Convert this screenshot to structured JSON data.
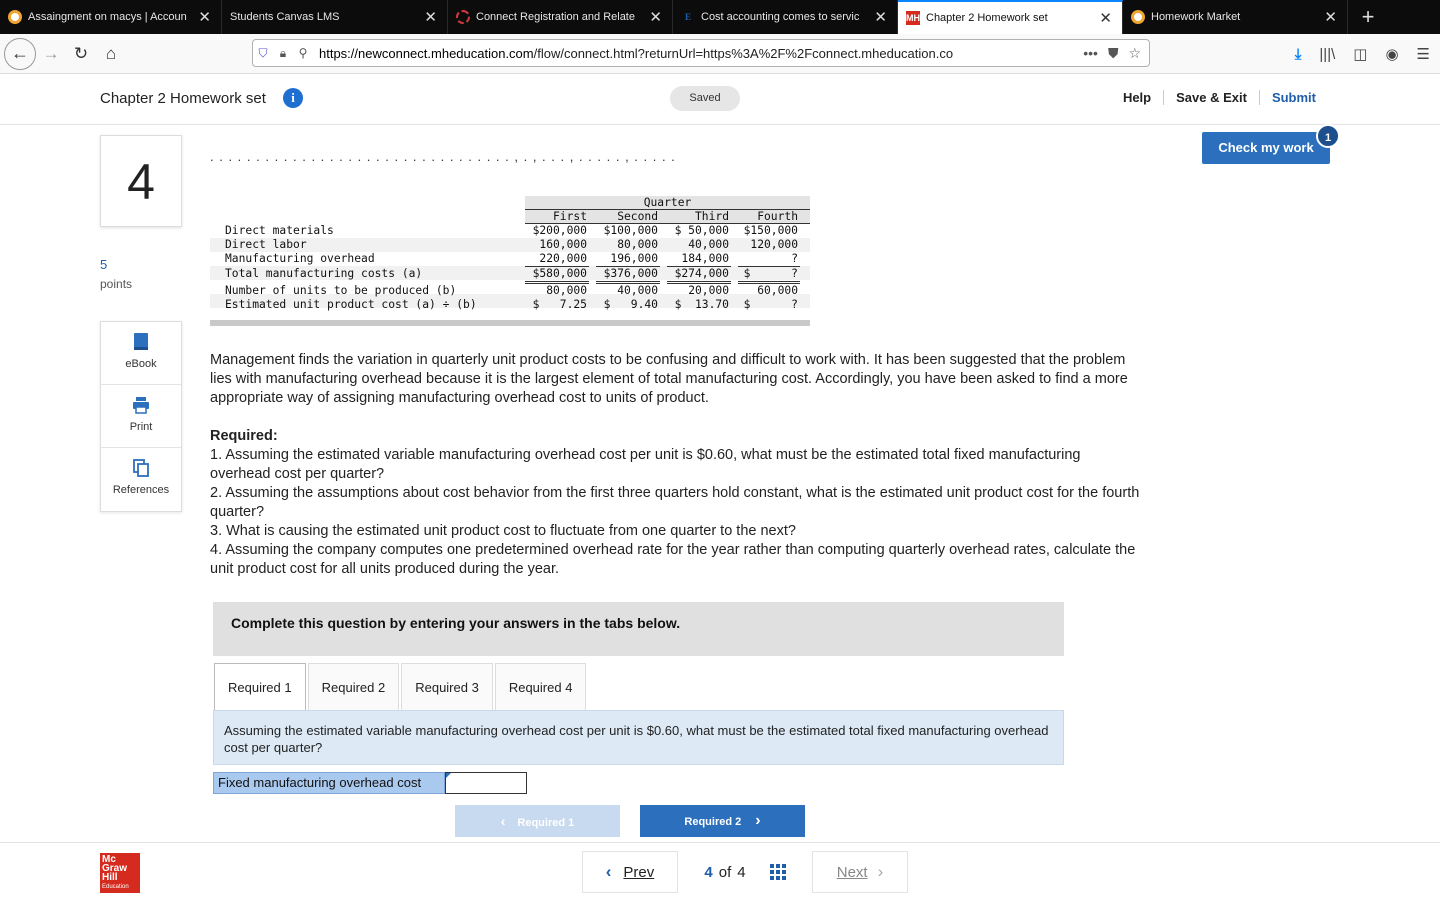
{
  "browser": {
    "tabs": [
      {
        "label": "Assaingment on macys | Accoun",
        "active": false
      },
      {
        "label": "Students Canvas LMS",
        "active": false
      },
      {
        "label": "Connect Registration and Relate",
        "active": false
      },
      {
        "label": "Cost accounting comes to servic",
        "active": false
      },
      {
        "label": "Chapter 2 Homework set",
        "active": true
      },
      {
        "label": "Homework Market",
        "active": false
      }
    ],
    "new_tab": "+",
    "url_host": "https://newconnect.mheducation.com",
    "url_path": "/flow/connect.html?returnUrl=https%3A%2F%2Fconnect.mheducation.co",
    "url_more": "•••"
  },
  "header": {
    "title": "Chapter 2 Homework set",
    "info": "i",
    "saved": "Saved",
    "help": "Help",
    "save_exit": "Save & Exit",
    "submit": "Submit"
  },
  "check_work": {
    "label": "Check my work",
    "badge": "1"
  },
  "question": {
    "number": "4",
    "points_value": "5",
    "points_label": "points",
    "tools": [
      {
        "label": "eBook",
        "icon": "book-icon"
      },
      {
        "label": "Print",
        "icon": "printer-icon"
      },
      {
        "label": "References",
        "icon": "copy-icon"
      }
    ]
  },
  "table": {
    "group_header": "Quarter",
    "columns": [
      "First",
      "Second",
      "Third",
      "Fourth"
    ],
    "rows": [
      {
        "label": "Direct materials",
        "values": [
          "$200,000",
          "$100,000",
          "$ 50,000",
          "$150,000"
        ]
      },
      {
        "label": "Direct labor",
        "values": [
          "160,000",
          "80,000",
          "40,000",
          "120,000"
        ]
      },
      {
        "label": "Manufacturing overhead",
        "values": [
          "220,000",
          "196,000",
          "184,000",
          "?"
        ]
      },
      {
        "label": "Total manufacturing costs (a)",
        "values": [
          "$580,000",
          "$376,000",
          "$274,000",
          "$      ?"
        ]
      },
      {
        "label": "Number of units to be produced (b)",
        "values": [
          "80,000",
          "40,000",
          "20,000",
          "60,000"
        ]
      },
      {
        "label": "Estimated unit product cost (a) ÷ (b)",
        "values": [
          "$   7.25",
          "$   9.40",
          "$  13.70",
          "$      ?"
        ]
      }
    ]
  },
  "body": {
    "intro": "Management finds the variation in quarterly unit product costs to be confusing and difficult to work with. It has been suggested that the problem lies with manufacturing overhead because it is the largest element of total manufacturing cost. Accordingly, you have been asked to find a more appropriate way of assigning manufacturing overhead cost to units of product.",
    "required_title": "Required:",
    "required_items": [
      "1. Assuming the estimated variable manufacturing overhead cost per unit is $0.60, what must be the estimated total fixed manufacturing overhead cost per quarter?",
      "2. Assuming the assumptions about cost behavior from the first three quarters hold constant, what is the estimated unit product cost for the fourth quarter?",
      "3. What is causing the estimated unit product cost to fluctuate from one quarter to the next?",
      "4. Assuming the company computes one predetermined overhead rate for the year rather than computing quarterly overhead rates, calculate the unit product cost for all units produced during the year."
    ]
  },
  "answer_area": {
    "instruction": "Complete this question by entering your answers in the tabs below.",
    "tabs": [
      "Required 1",
      "Required 2",
      "Required 3",
      "Required 4"
    ],
    "active_tab": 0,
    "prompt": "Assuming the estimated variable manufacturing overhead cost per unit is $0.60, what must be the estimated total fixed manufacturing overhead cost per quarter?",
    "field_label": "Fixed manufacturing overhead cost",
    "field_value": "",
    "prev_button": "Required 1",
    "next_button": "Required 2"
  },
  "footer": {
    "logo_lines": [
      "Mc",
      "Graw",
      "Hill"
    ],
    "logo_sub": "Education",
    "prev": "Prev",
    "current": "4",
    "of": "of",
    "total": "4",
    "next": "Next"
  },
  "colors": {
    "accent": "#2c6fbd",
    "brand_red": "#d52b1e",
    "panel_blue": "#ddeaf6"
  }
}
